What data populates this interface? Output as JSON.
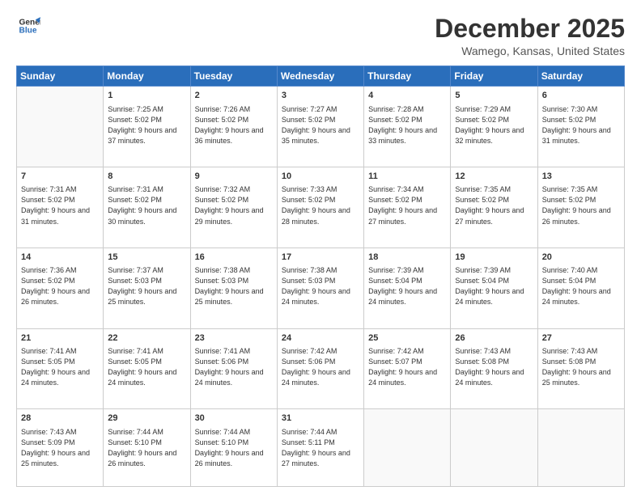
{
  "header": {
    "logo_line1": "General",
    "logo_line2": "Blue",
    "month": "December 2025",
    "location": "Wamego, Kansas, United States"
  },
  "weekdays": [
    "Sunday",
    "Monday",
    "Tuesday",
    "Wednesday",
    "Thursday",
    "Friday",
    "Saturday"
  ],
  "rows": [
    [
      {
        "day": "",
        "sunrise": "",
        "sunset": "",
        "daylight": ""
      },
      {
        "day": "1",
        "sunrise": "Sunrise: 7:25 AM",
        "sunset": "Sunset: 5:02 PM",
        "daylight": "Daylight: 9 hours and 37 minutes."
      },
      {
        "day": "2",
        "sunrise": "Sunrise: 7:26 AM",
        "sunset": "Sunset: 5:02 PM",
        "daylight": "Daylight: 9 hours and 36 minutes."
      },
      {
        "day": "3",
        "sunrise": "Sunrise: 7:27 AM",
        "sunset": "Sunset: 5:02 PM",
        "daylight": "Daylight: 9 hours and 35 minutes."
      },
      {
        "day": "4",
        "sunrise": "Sunrise: 7:28 AM",
        "sunset": "Sunset: 5:02 PM",
        "daylight": "Daylight: 9 hours and 33 minutes."
      },
      {
        "day": "5",
        "sunrise": "Sunrise: 7:29 AM",
        "sunset": "Sunset: 5:02 PM",
        "daylight": "Daylight: 9 hours and 32 minutes."
      },
      {
        "day": "6",
        "sunrise": "Sunrise: 7:30 AM",
        "sunset": "Sunset: 5:02 PM",
        "daylight": "Daylight: 9 hours and 31 minutes."
      }
    ],
    [
      {
        "day": "7",
        "sunrise": "Sunrise: 7:31 AM",
        "sunset": "Sunset: 5:02 PM",
        "daylight": "Daylight: 9 hours and 31 minutes."
      },
      {
        "day": "8",
        "sunrise": "Sunrise: 7:31 AM",
        "sunset": "Sunset: 5:02 PM",
        "daylight": "Daylight: 9 hours and 30 minutes."
      },
      {
        "day": "9",
        "sunrise": "Sunrise: 7:32 AM",
        "sunset": "Sunset: 5:02 PM",
        "daylight": "Daylight: 9 hours and 29 minutes."
      },
      {
        "day": "10",
        "sunrise": "Sunrise: 7:33 AM",
        "sunset": "Sunset: 5:02 PM",
        "daylight": "Daylight: 9 hours and 28 minutes."
      },
      {
        "day": "11",
        "sunrise": "Sunrise: 7:34 AM",
        "sunset": "Sunset: 5:02 PM",
        "daylight": "Daylight: 9 hours and 27 minutes."
      },
      {
        "day": "12",
        "sunrise": "Sunrise: 7:35 AM",
        "sunset": "Sunset: 5:02 PM",
        "daylight": "Daylight: 9 hours and 27 minutes."
      },
      {
        "day": "13",
        "sunrise": "Sunrise: 7:35 AM",
        "sunset": "Sunset: 5:02 PM",
        "daylight": "Daylight: 9 hours and 26 minutes."
      }
    ],
    [
      {
        "day": "14",
        "sunrise": "Sunrise: 7:36 AM",
        "sunset": "Sunset: 5:02 PM",
        "daylight": "Daylight: 9 hours and 26 minutes."
      },
      {
        "day": "15",
        "sunrise": "Sunrise: 7:37 AM",
        "sunset": "Sunset: 5:03 PM",
        "daylight": "Daylight: 9 hours and 25 minutes."
      },
      {
        "day": "16",
        "sunrise": "Sunrise: 7:38 AM",
        "sunset": "Sunset: 5:03 PM",
        "daylight": "Daylight: 9 hours and 25 minutes."
      },
      {
        "day": "17",
        "sunrise": "Sunrise: 7:38 AM",
        "sunset": "Sunset: 5:03 PM",
        "daylight": "Daylight: 9 hours and 24 minutes."
      },
      {
        "day": "18",
        "sunrise": "Sunrise: 7:39 AM",
        "sunset": "Sunset: 5:04 PM",
        "daylight": "Daylight: 9 hours and 24 minutes."
      },
      {
        "day": "19",
        "sunrise": "Sunrise: 7:39 AM",
        "sunset": "Sunset: 5:04 PM",
        "daylight": "Daylight: 9 hours and 24 minutes."
      },
      {
        "day": "20",
        "sunrise": "Sunrise: 7:40 AM",
        "sunset": "Sunset: 5:04 PM",
        "daylight": "Daylight: 9 hours and 24 minutes."
      }
    ],
    [
      {
        "day": "21",
        "sunrise": "Sunrise: 7:41 AM",
        "sunset": "Sunset: 5:05 PM",
        "daylight": "Daylight: 9 hours and 24 minutes."
      },
      {
        "day": "22",
        "sunrise": "Sunrise: 7:41 AM",
        "sunset": "Sunset: 5:05 PM",
        "daylight": "Daylight: 9 hours and 24 minutes."
      },
      {
        "day": "23",
        "sunrise": "Sunrise: 7:41 AM",
        "sunset": "Sunset: 5:06 PM",
        "daylight": "Daylight: 9 hours and 24 minutes."
      },
      {
        "day": "24",
        "sunrise": "Sunrise: 7:42 AM",
        "sunset": "Sunset: 5:06 PM",
        "daylight": "Daylight: 9 hours and 24 minutes."
      },
      {
        "day": "25",
        "sunrise": "Sunrise: 7:42 AM",
        "sunset": "Sunset: 5:07 PM",
        "daylight": "Daylight: 9 hours and 24 minutes."
      },
      {
        "day": "26",
        "sunrise": "Sunrise: 7:43 AM",
        "sunset": "Sunset: 5:08 PM",
        "daylight": "Daylight: 9 hours and 24 minutes."
      },
      {
        "day": "27",
        "sunrise": "Sunrise: 7:43 AM",
        "sunset": "Sunset: 5:08 PM",
        "daylight": "Daylight: 9 hours and 25 minutes."
      }
    ],
    [
      {
        "day": "28",
        "sunrise": "Sunrise: 7:43 AM",
        "sunset": "Sunset: 5:09 PM",
        "daylight": "Daylight: 9 hours and 25 minutes."
      },
      {
        "day": "29",
        "sunrise": "Sunrise: 7:44 AM",
        "sunset": "Sunset: 5:10 PM",
        "daylight": "Daylight: 9 hours and 26 minutes."
      },
      {
        "day": "30",
        "sunrise": "Sunrise: 7:44 AM",
        "sunset": "Sunset: 5:10 PM",
        "daylight": "Daylight: 9 hours and 26 minutes."
      },
      {
        "day": "31",
        "sunrise": "Sunrise: 7:44 AM",
        "sunset": "Sunset: 5:11 PM",
        "daylight": "Daylight: 9 hours and 27 minutes."
      },
      {
        "day": "",
        "sunrise": "",
        "sunset": "",
        "daylight": ""
      },
      {
        "day": "",
        "sunrise": "",
        "sunset": "",
        "daylight": ""
      },
      {
        "day": "",
        "sunrise": "",
        "sunset": "",
        "daylight": ""
      }
    ]
  ]
}
